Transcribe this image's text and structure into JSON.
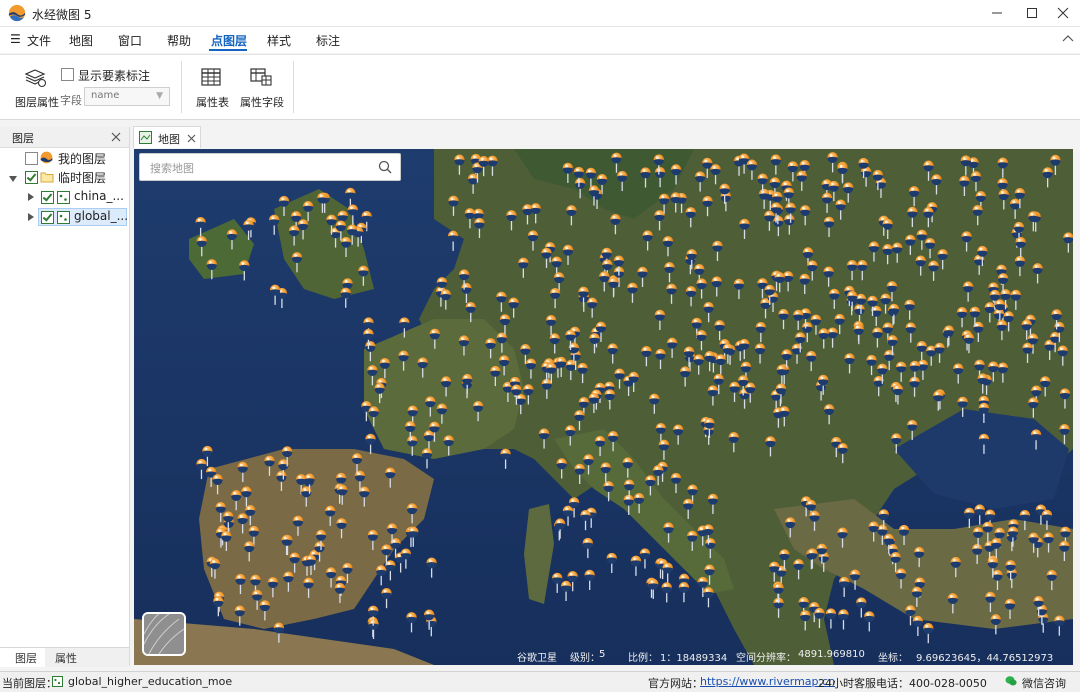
{
  "window": {
    "title": "水经微图 5",
    "controls": [
      "minimize",
      "maximize",
      "close"
    ]
  },
  "menu": {
    "hamburger": "☰",
    "items": [
      "文件",
      "地图",
      "窗口",
      "帮助",
      "点图层",
      "样式",
      "标注"
    ],
    "active": "点图层"
  },
  "ribbon": {
    "layer_props_label": "图层属性",
    "show_labels_label": "显示要素标注",
    "show_labels_checked": false,
    "field_label": "字段",
    "field_value": "name",
    "attr_table_label": "属性表",
    "attr_field_label": "属性字段"
  },
  "layers_panel": {
    "title": "图层",
    "close": "✕",
    "tree": [
      {
        "label": "我的图层",
        "checked": false
      },
      {
        "label": "临时图层",
        "checked": true
      },
      {
        "label": "china_...",
        "checked": true
      },
      {
        "label": "global_...",
        "checked": true
      }
    ],
    "tabs": [
      "图层",
      "属性"
    ]
  },
  "doc_tab": {
    "label": "地图",
    "close": "✕"
  },
  "map": {
    "search_placeholder": "搜索地图",
    "source": "谷歌卫星",
    "level_label": "级别：",
    "level_value": "5",
    "scale_label": "比例：",
    "scale_value": "1：18489334",
    "resolution_label": "空间分辨率：",
    "resolution_value": "4891.969810",
    "coord_label": "坐标：",
    "coord_value": "9.69623645，44.76512973"
  },
  "statusbar": {
    "current_layer_label": "当前图层：",
    "current_layer_value": "global_higher_education_moe",
    "website_label": "官方网站：",
    "website_url": "https://www.rivermap.cn",
    "hotline": "24小时客服电话：400-028-0050",
    "wechat": "微信咨询"
  },
  "colors": {
    "accent": "#1565c0",
    "marker_orange": "#f29a2e",
    "marker_navy": "#1e3b6e",
    "sea": "#1f3a6b",
    "land": "#4b5e3a"
  }
}
